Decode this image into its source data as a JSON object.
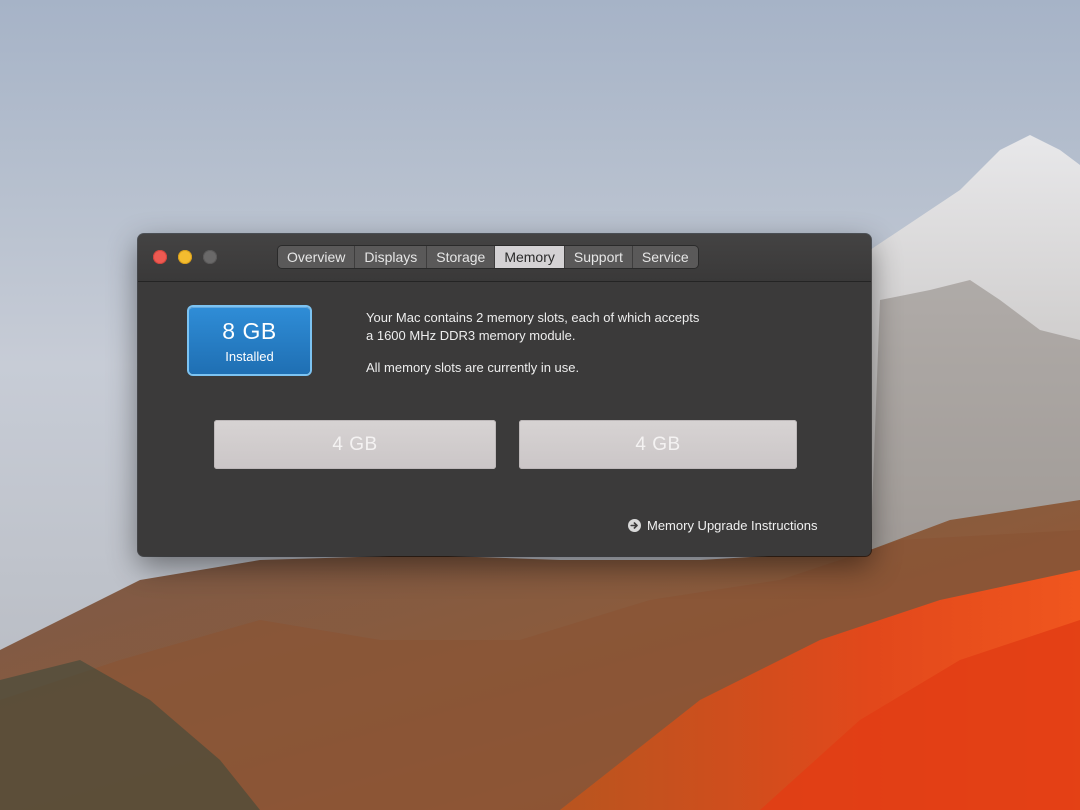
{
  "window": {
    "tabs": [
      {
        "label": "Overview"
      },
      {
        "label": "Displays"
      },
      {
        "label": "Storage"
      },
      {
        "label": "Memory",
        "active": true
      },
      {
        "label": "Support"
      },
      {
        "label": "Service"
      }
    ],
    "active_tab": "Memory"
  },
  "memory": {
    "installed_size": "8 GB",
    "installed_label": "Installed",
    "description_line1": "Your Mac contains 2 memory slots, each of which accepts",
    "description_line2": "a 1600 MHz DDR3 memory module.",
    "status": "All memory slots are currently in use.",
    "slots": [
      {
        "label": "4 GB"
      },
      {
        "label": "4 GB"
      }
    ],
    "upgrade_link": "Memory Upgrade Instructions"
  },
  "colors": {
    "window_bg": "#3b3a3a",
    "badge_blue": "#1f6fb3",
    "close": "#ee5a52",
    "minimize": "#f4bc2f",
    "zoom_inactive": "#6a6969"
  },
  "icons": {
    "upgrade_link_icon": "circle-arrow-right-icon"
  }
}
